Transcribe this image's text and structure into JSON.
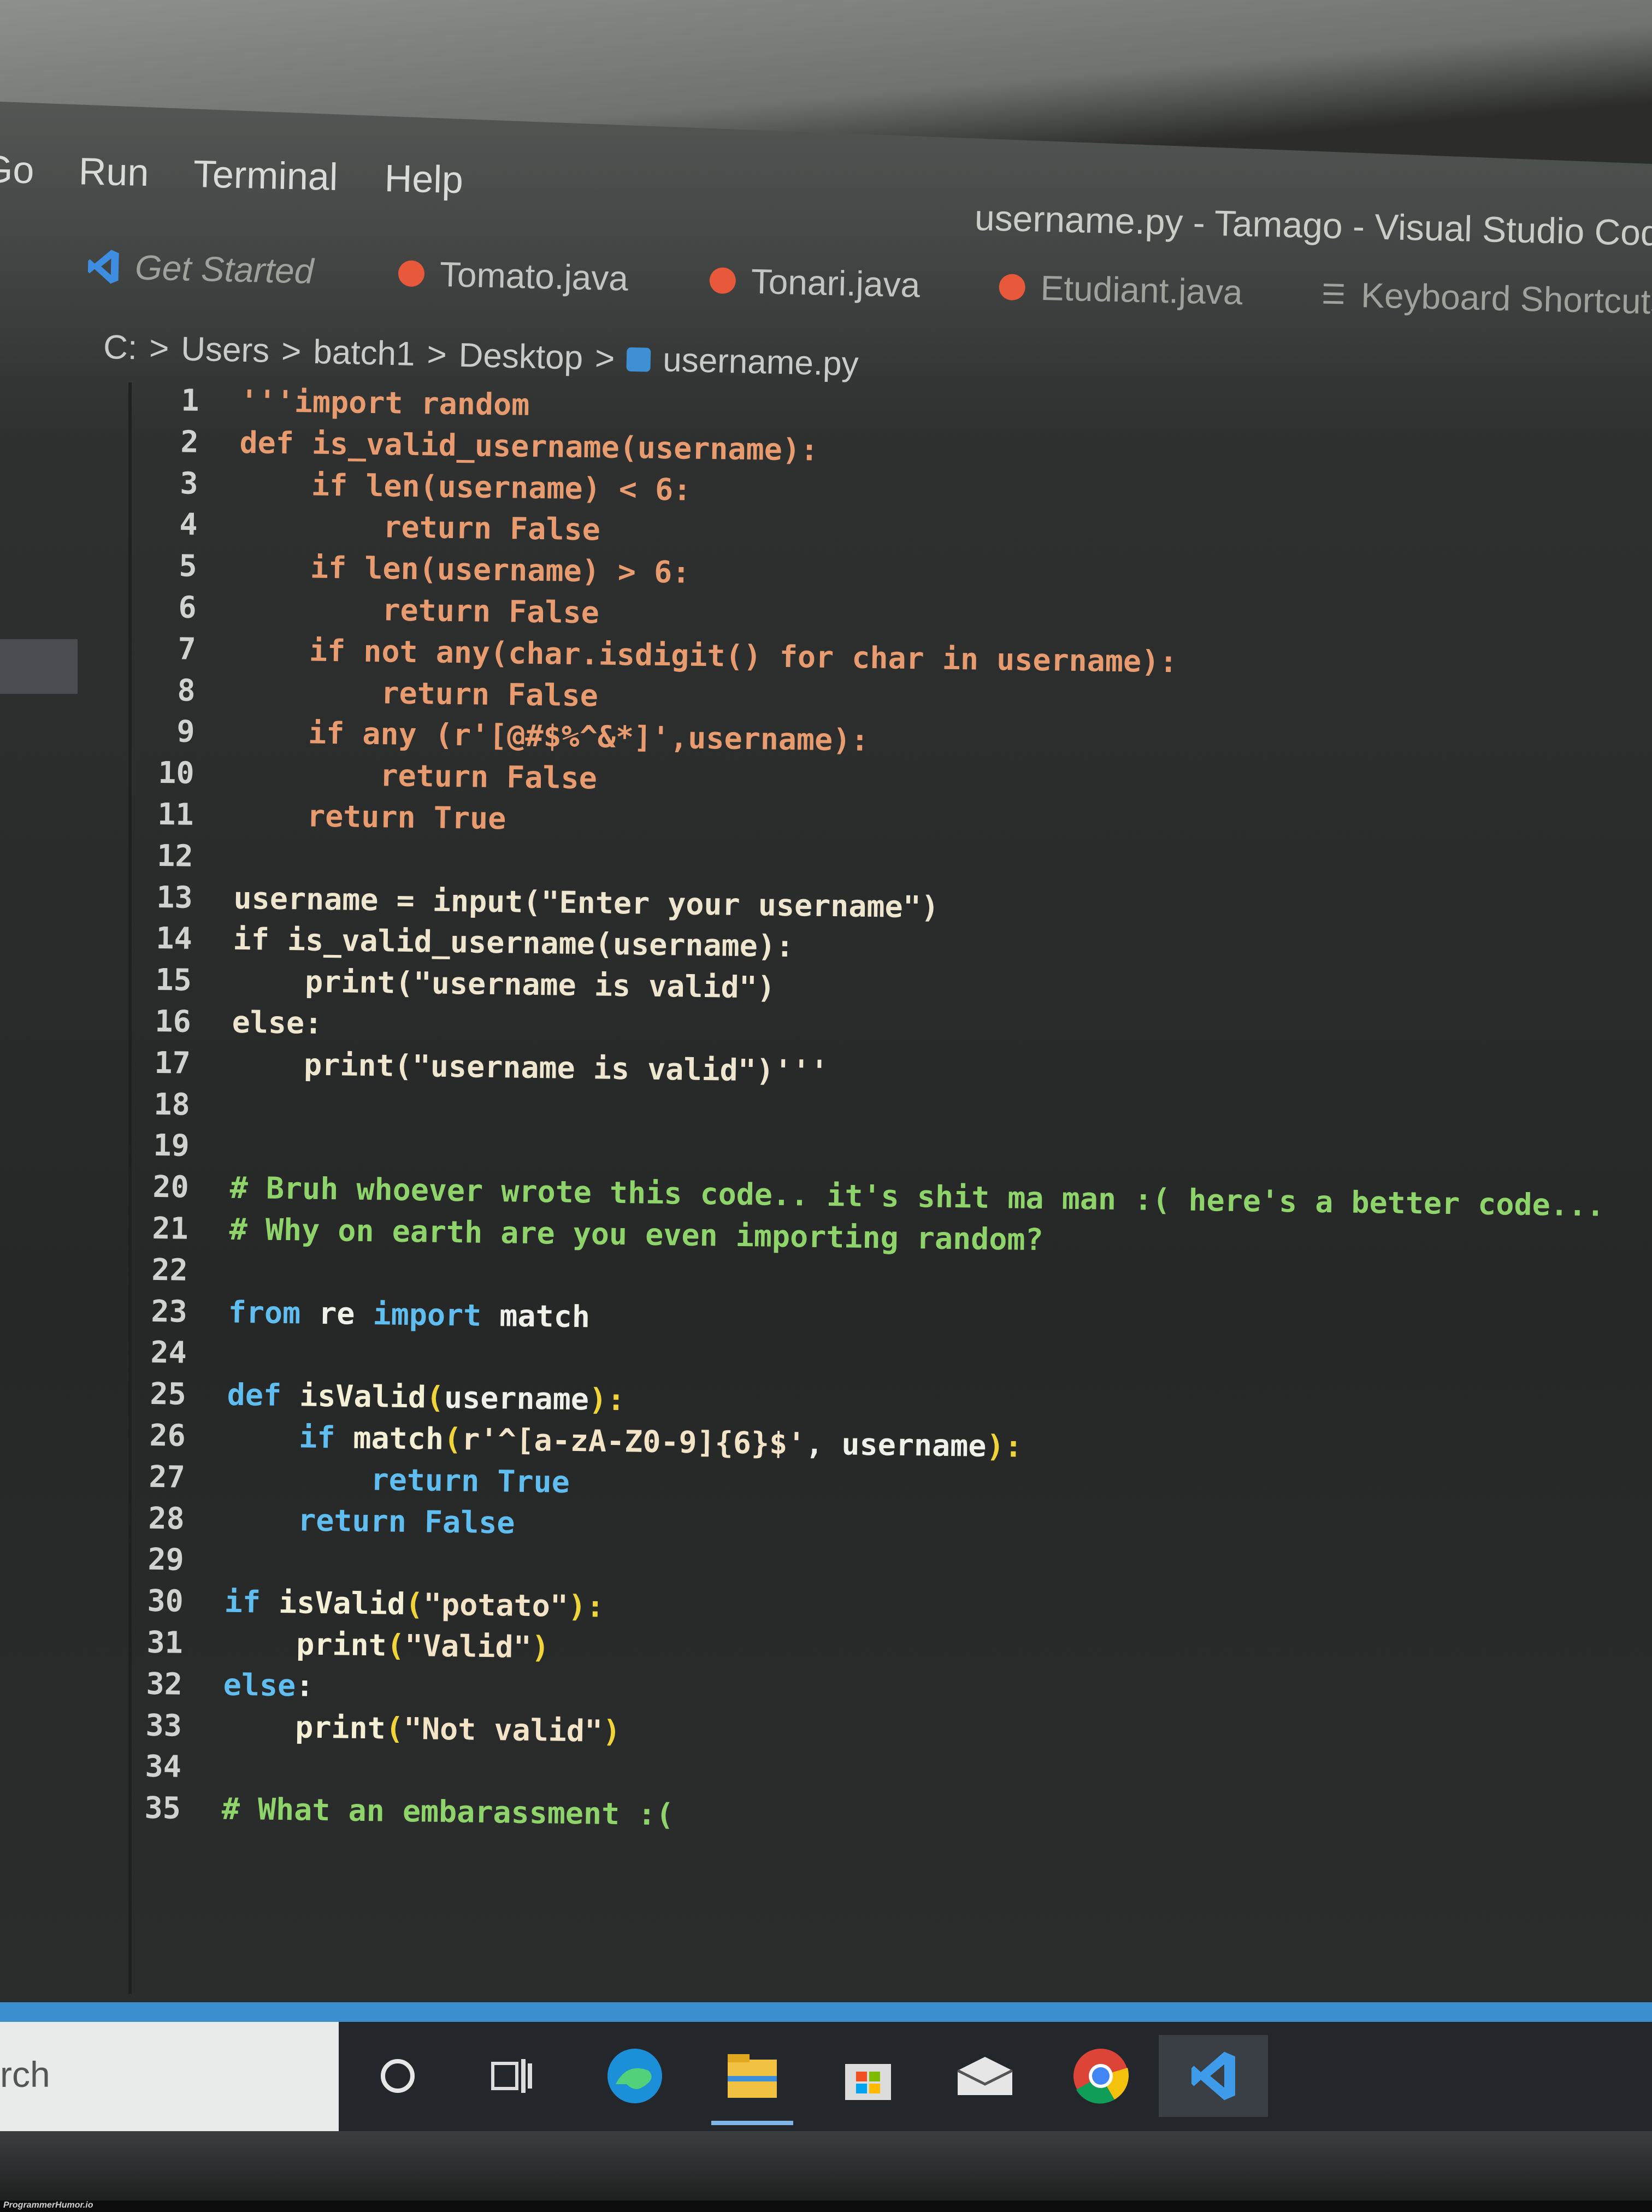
{
  "window": {
    "title": "username.py - Tamago - Visual Studio Code"
  },
  "menu": [
    "Go",
    "Run",
    "Terminal",
    "Help"
  ],
  "tabs": [
    {
      "label": "Get Started",
      "icon": "vscode-icon"
    },
    {
      "label": "Tomato.java",
      "icon": "java-icon"
    },
    {
      "label": "Tonari.java",
      "icon": "java-icon"
    },
    {
      "label": "Etudiant.java",
      "icon": "java-icon"
    },
    {
      "label": "Keyboard Shortcuts",
      "icon": "keyboard-icon"
    }
  ],
  "breadcrumb": [
    "C:",
    ">",
    "Users",
    ">",
    "batch1",
    ">",
    "Desktop",
    ">",
    "username.py"
  ],
  "colors": {
    "string": "#e79b6e",
    "comment": "#8fd46a",
    "keyword": "#5fbdf0",
    "bracket": "#f0d43a",
    "status_bar": "#3b8fcf"
  },
  "code": [
    [
      [
        "'''import random",
        "str"
      ]
    ],
    [
      [
        "def is_valid_username(username):",
        "str"
      ]
    ],
    [
      [
        "    if len(username) < 6:",
        "str"
      ]
    ],
    [
      [
        "        return False",
        "str"
      ]
    ],
    [
      [
        "    if len(username) > 6:",
        "str"
      ]
    ],
    [
      [
        "        return False",
        "str"
      ]
    ],
    [
      [
        "    if not any(char.isdigit() for char in username):",
        "str"
      ]
    ],
    [
      [
        "        return False",
        "str"
      ]
    ],
    [
      [
        "    if any (r'[@#$%^&*]',username):",
        "str"
      ]
    ],
    [
      [
        "        return False",
        "str"
      ]
    ],
    [
      [
        "    return True",
        "str"
      ]
    ],
    [],
    [
      [
        "username = input(\"Enter your username\")",
        "str_b"
      ]
    ],
    [
      [
        "if is_valid_username(username):",
        "str_b"
      ]
    ],
    [
      [
        "    print(\"username is valid\")",
        "str_b"
      ]
    ],
    [
      [
        "else:",
        "str_b"
      ]
    ],
    [
      [
        "    print(\"username is valid\")'''",
        "str_b"
      ]
    ],
    [],
    [],
    [
      [
        "# Bruh whoever wrote this code.. it's shit ma man :( here's a better code...",
        "cm"
      ]
    ],
    [
      [
        "# Why on earth are you even importing random?",
        "cm"
      ]
    ],
    [],
    [
      [
        "from",
        "kw"
      ],
      [
        " re ",
        "id"
      ],
      [
        "import",
        "kw"
      ],
      [
        " match",
        "id"
      ]
    ],
    [],
    [
      [
        "def",
        "kw"
      ],
      [
        " isValid",
        "fn"
      ],
      [
        "(",
        "pn"
      ],
      [
        "username",
        "id"
      ],
      [
        "):",
        "pn"
      ]
    ],
    [
      [
        "    ",
        "id"
      ],
      [
        "if",
        "kw"
      ],
      [
        " match",
        "fn"
      ],
      [
        "(",
        "pn"
      ],
      [
        "r'^[a-zA-Z0-9]{6}$'",
        "sv"
      ],
      [
        ", username",
        "id"
      ],
      [
        "):",
        "pn"
      ]
    ],
    [
      [
        "        return True",
        "kw"
      ]
    ],
    [
      [
        "    return False",
        "kw"
      ]
    ],
    [],
    [
      [
        "if",
        "kw"
      ],
      [
        " isValid",
        "fn"
      ],
      [
        "(",
        "pn"
      ],
      [
        "\"potato\"",
        "sv"
      ],
      [
        "):",
        "pn"
      ]
    ],
    [
      [
        "    print",
        "fn"
      ],
      [
        "(",
        "pn"
      ],
      [
        "\"Valid\"",
        "sv"
      ],
      [
        ")",
        "pn"
      ]
    ],
    [
      [
        "else",
        "kw"
      ],
      [
        ":",
        "id"
      ]
    ],
    [
      [
        "    print",
        "fn"
      ],
      [
        "(",
        "pn"
      ],
      [
        "\"Not valid\"",
        "sv"
      ],
      [
        ")",
        "pn"
      ]
    ],
    [],
    [
      [
        "# What an embarassment :(",
        "cm"
      ]
    ]
  ],
  "taskbar": {
    "search_text": "rch",
    "icons": [
      "cortana-icon",
      "task-view-icon",
      "edge-icon",
      "file-explorer-icon",
      "store-icon",
      "mail-icon",
      "chrome-icon",
      "vscode-icon"
    ]
  },
  "watermark": "ProgrammerHumor.io"
}
